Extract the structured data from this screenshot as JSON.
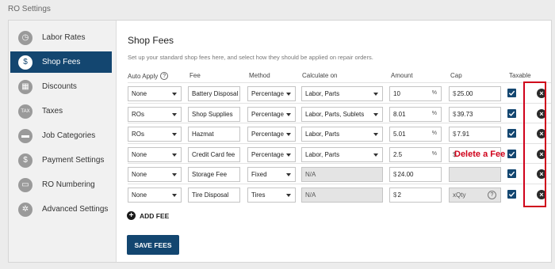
{
  "window": {
    "title": "RO Settings"
  },
  "sidebar": {
    "items": [
      {
        "label": "Labor Rates",
        "icon": "stopwatch-icon",
        "glyph": "◷",
        "active": false
      },
      {
        "label": "Shop Fees",
        "icon": "fee-icon",
        "glyph": "$",
        "active": true
      },
      {
        "label": "Discounts",
        "icon": "discount-icon",
        "glyph": "▦",
        "active": false
      },
      {
        "label": "Taxes",
        "icon": "tax-icon",
        "glyph": "TAX",
        "active": false
      },
      {
        "label": "Job Categories",
        "icon": "folder-icon",
        "glyph": "▬",
        "active": false
      },
      {
        "label": "Payment Settings",
        "icon": "dollar-icon",
        "glyph": "$",
        "active": false
      },
      {
        "label": "RO Numbering",
        "icon": "car-icon",
        "glyph": "▭",
        "active": false
      },
      {
        "label": "Advanced Settings",
        "icon": "gear-icon",
        "glyph": "✲",
        "active": false
      }
    ]
  },
  "main": {
    "heading": "Shop Fees",
    "description": "Set up your standard shop fees here, and select how they should be applied on repair orders.",
    "columns": {
      "auto_apply": "Auto Apply",
      "fee": "Fee",
      "method": "Method",
      "calculate_on": "Calculate on",
      "amount": "Amount",
      "cap": "Cap",
      "taxable": "Taxable"
    },
    "rows": [
      {
        "auto_apply": "None",
        "fee": "Battery Disposal",
        "method": "Percentage",
        "calc": "Labor, Parts",
        "amount": "10",
        "amount_unit": "%",
        "cap_prefix": "$",
        "cap": "25.00",
        "taxable": true
      },
      {
        "auto_apply": "ROs",
        "fee": "Shop Supplies",
        "method": "Percentage",
        "calc": "Labor, Parts, Sublets",
        "amount": "8.01",
        "amount_unit": "%",
        "cap_prefix": "$",
        "cap": "39.73",
        "taxable": true
      },
      {
        "auto_apply": "ROs",
        "fee": "Hazmat",
        "method": "Percentage",
        "calc": "Labor, Parts",
        "amount": "5.01",
        "amount_unit": "%",
        "cap_prefix": "$",
        "cap": "7.91",
        "taxable": true
      },
      {
        "auto_apply": "None",
        "fee": "Credit Card fee",
        "method": "Percentage",
        "calc": "Labor, Parts",
        "amount": "2.5",
        "amount_unit": "%",
        "cap_prefix": "$",
        "cap": "",
        "taxable": true
      },
      {
        "auto_apply": "None",
        "fee": "Storage Fee",
        "method": "Fixed",
        "calc": "N/A",
        "amount_prefix": "$",
        "amount": "24.00",
        "cap": "",
        "taxable": true
      },
      {
        "auto_apply": "None",
        "fee": "Tire Disposal",
        "method": "Tires",
        "calc": "N/A",
        "amount_prefix": "$",
        "amount": "2",
        "cap": "xQty",
        "taxable": true
      }
    ],
    "add_fee_label": "ADD FEE",
    "save_label": "SAVE FEES"
  },
  "annotation": {
    "text": "Delete a Fee",
    "color": "#d0021b"
  },
  "colors": {
    "primary": "#134670",
    "highlight": "#d0021b"
  }
}
